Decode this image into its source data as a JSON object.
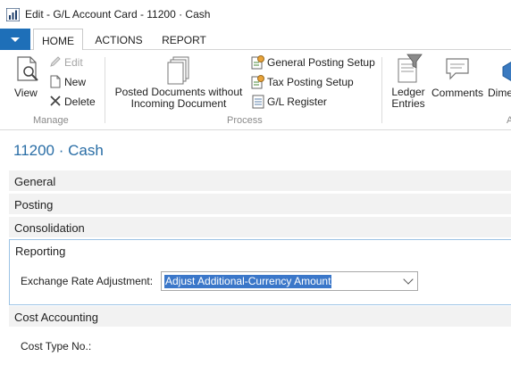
{
  "window": {
    "title": "Edit - G/L Account Card - 11200 · Cash"
  },
  "ribbon_tabs": [
    {
      "label": "HOME",
      "active": true
    },
    {
      "label": "ACTIONS",
      "active": false
    },
    {
      "label": "REPORT",
      "active": false
    }
  ],
  "ribbon": {
    "view": "View",
    "edit": "Edit",
    "new": "New",
    "delete": "Delete",
    "posted_docs_line1": "Posted Documents without",
    "posted_docs_line2": "Incoming Document",
    "general_posting_setup": "General Posting Setup",
    "tax_posting_setup": "Tax Posting Setup",
    "gl_register": "G/L Register",
    "ledger_line1": "Ledger",
    "ledger_line2": "Entries",
    "comments": "Comments",
    "dimensions_partial": "Dime",
    "group_manage": "Manage",
    "group_process": "Process",
    "group_partial": "A"
  },
  "page": {
    "title": "11200 · Cash"
  },
  "fasttabs": {
    "general": "General",
    "posting": "Posting",
    "consolidation": "Consolidation",
    "reporting": "Reporting",
    "cost_accounting": "Cost Accounting"
  },
  "fields": {
    "exchange_rate_label": "Exchange Rate Adjustment:",
    "exchange_rate_value": "Adjust Additional-Currency Amount",
    "cost_type_label": "Cost Type No.:"
  },
  "colors": {
    "accent": "#1e6fb8",
    "title_blue": "#2a6ea6",
    "focus_border": "#9cc3e5"
  }
}
